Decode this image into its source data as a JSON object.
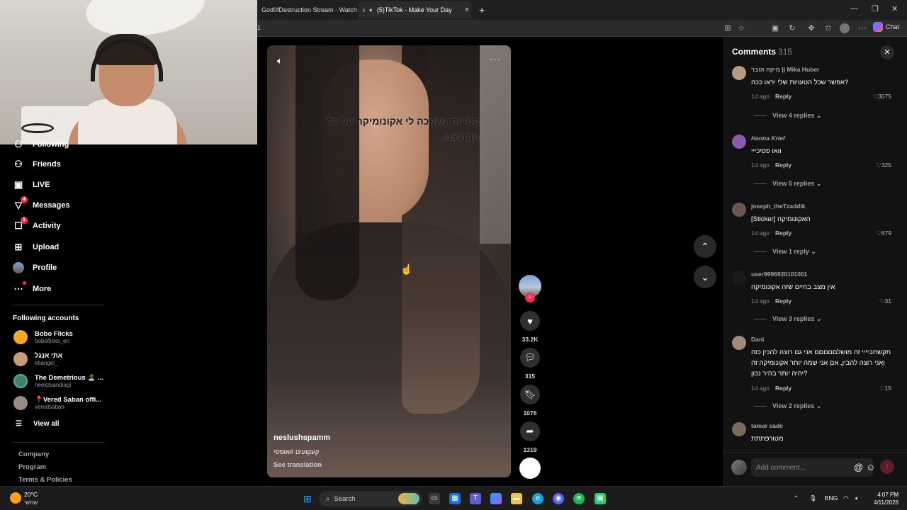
{
  "browser": {
    "tabs": [
      {
        "title": "God0fDestruction Stream - Watch",
        "active": false
      },
      {
        "title": "(5)TikTok - Make Your Day",
        "active": true
      }
    ],
    "new_tab_symbol": "+",
    "address_text": "1",
    "chat_label": "Chat"
  },
  "sidebar": {
    "nav": [
      {
        "label": "Following",
        "icon": "following-icon"
      },
      {
        "label": "Friends",
        "icon": "friends-icon"
      },
      {
        "label": "LIVE",
        "icon": "live-icon"
      },
      {
        "label": "Messages",
        "icon": "messages-icon",
        "badge": "4"
      },
      {
        "label": "Activity",
        "icon": "activity-icon",
        "badge": "1"
      },
      {
        "label": "Upload",
        "icon": "upload-icon"
      },
      {
        "label": "Profile",
        "icon": "profile-avatar"
      },
      {
        "label": "More",
        "icon": "more-icon"
      }
    ],
    "following_title": "Following accounts",
    "accounts": [
      {
        "name": "Bobo Flicks",
        "handle": "boboflicks_en",
        "color": "#f5a623"
      },
      {
        "name": "אתי אנגל",
        "handle": "etiangel_",
        "color": "#c89a7a"
      },
      {
        "name": "The Demetrious 🏝️ ...",
        "handle": "neekzsandiagi",
        "color": "#4a7a6a"
      },
      {
        "name": "📍Vered Saban offi...",
        "handle": "veredsaban",
        "color": "#9a8a84"
      }
    ],
    "view_all": "View all",
    "footer": [
      "Company",
      "Program",
      "Terms & Policies"
    ]
  },
  "video": {
    "caption": "בטעות נשפכה לי אקונומיקה על כל החולצה..",
    "author": "neslushspamm",
    "description": "קעקועים #אופסי",
    "see_translation": "See translation",
    "more_symbol": "···"
  },
  "actions": {
    "likes": "33.2K",
    "comments": "315",
    "saves": "1076",
    "shares": "1319"
  },
  "comments_panel": {
    "title": "Comments",
    "count": "315",
    "items": [
      {
        "user": "מיקה הובר || Mika Huber",
        "text": "אפשר שכל הטעויות שלי יראו ככה?",
        "time": "1d ago",
        "reply": "Reply",
        "likes": "3075",
        "view_replies": "View 4 replies",
        "avatar_color": "#b59a84"
      },
      {
        "user": "Hanna Krief",
        "text": "וואו פסיכייי",
        "time": "1d ago",
        "reply": "Reply",
        "likes": "325",
        "view_replies": "View 5 replies",
        "avatar_color": "#8a5ab0"
      },
      {
        "user": "joseph_theTzaddik",
        "text": "[Sticker] האקונומיקה",
        "time": "1d ago",
        "reply": "Reply",
        "likes": "679",
        "view_replies": "View 1 reply",
        "avatar_color": "#6a5550"
      },
      {
        "user": "user9996920101001",
        "text": "אין מצב בחיים שזה אקונומיקה",
        "time": "1d ago",
        "reply": "Reply",
        "likes": "31",
        "view_replies": "View 3 replies",
        "avatar_color": "#1a1a1a"
      },
      {
        "user": "Dani",
        "text": "תקשחביייי זה מושלםםםםם אני גם רוצה להכין כזה ואני רוצה להבין, אם אני שמה יותר אקונומיקה זה יהיה יותר בהיר נכון?",
        "time": "1d ago",
        "reply": "Reply",
        "likes": "15",
        "view_replies": "View 2 replies",
        "avatar_color": "#a08a7a"
      },
      {
        "user": "tamar sade",
        "text": "מטורפתתת",
        "avatar_color": "#7a6a5a"
      }
    ],
    "input_placeholder": "Add comment..."
  },
  "taskbar": {
    "temperature": "20°C",
    "condition": "שמשי",
    "search_label": "Search",
    "language": "ENG",
    "time": "4:07 PM",
    "date": "4/11/2026"
  },
  "colors": {
    "accent": "#fe2c55",
    "panel_bg": "#121212",
    "chrome_bg": "#1f1f1f"
  }
}
